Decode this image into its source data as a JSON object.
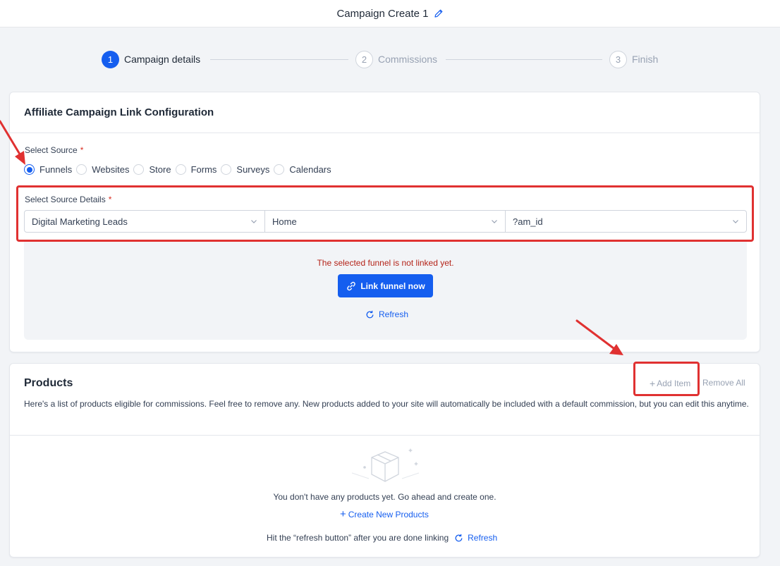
{
  "header": {
    "title": "Campaign Create 1",
    "edit_icon": "pencil-icon"
  },
  "stepper": {
    "steps": [
      {
        "num": "1",
        "label": "Campaign details",
        "state": "active"
      },
      {
        "num": "2",
        "label": "Commissions",
        "state": "inactive"
      },
      {
        "num": "3",
        "label": "Finish",
        "state": "inactive"
      }
    ]
  },
  "link_config": {
    "title": "Affiliate Campaign Link Configuration",
    "source_label": "Select Source",
    "required_mark": "*",
    "sources": [
      "Funnels",
      "Websites",
      "Store",
      "Forms",
      "Surveys",
      "Calendars"
    ],
    "selected_source": "Funnels",
    "details_label": "Select Source Details",
    "selects": [
      "Digital Marketing Leads",
      "Home",
      "?am_id"
    ],
    "warning": "The selected funnel is not linked yet.",
    "link_button": "Link funnel now",
    "refresh": "Refresh"
  },
  "products": {
    "title": "Products",
    "add_item": "Add Item",
    "remove_all": "Remove All",
    "description": "Here's a list of products eligible for commissions. Feel free to remove any. New products added to your site will automatically be included with a default commission, but you can edit this anytime.",
    "empty_text": "You don't have any products yet. Go ahead and create one.",
    "create_link": "Create New Products",
    "hint": "Hit the “refresh button” after you are done linking",
    "refresh": "Refresh"
  },
  "colors": {
    "accent": "#155eef",
    "warning": "#b42318",
    "annotation": "#e03131"
  }
}
